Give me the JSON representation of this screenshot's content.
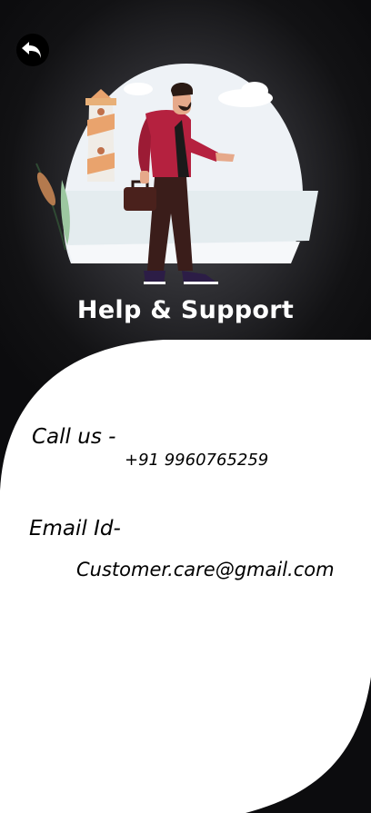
{
  "header": {
    "back_icon": "back-arrow-icon",
    "title": "Help & Support"
  },
  "contact": {
    "call_label": "Call us -",
    "phone": "+91 9960765259",
    "email_label": "Email Id-",
    "email": "Customer.care@gmail.com"
  },
  "colors": {
    "background": "#121214",
    "panel": "#ffffff",
    "title": "#ffffff",
    "jacket": "#b5213f"
  }
}
